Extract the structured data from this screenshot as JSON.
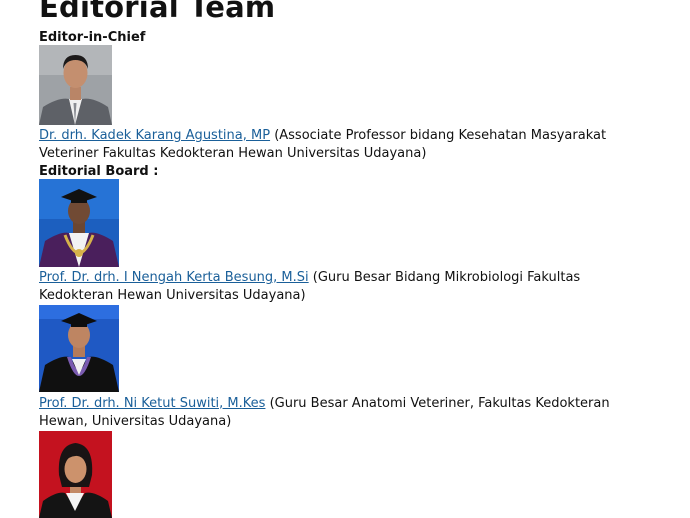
{
  "page": {
    "title": "Editorial Team"
  },
  "editor_in_chief": {
    "heading": "Editor-in-Chief",
    "member": {
      "name": "Dr. drh. Kadek Karang Agustina, MP",
      "description": " (Associate Professor bidang Kesehatan Masyarakat Veteriner Fakultas Kedokteran Hewan Universitas Udayana)"
    }
  },
  "editorial_board": {
    "heading": "Editorial Board :",
    "members": [
      {
        "name": "Prof. Dr. drh. I Nengah Kerta Besung, M.Si",
        "description": " (Guru Besar Bidang Mikrobiologi Fakultas Kedokteran Hewan Universitas Udayana)"
      },
      {
        "name": "Prof. Dr. drh. Ni Ketut Suwiti, M.Kes",
        "description": " (Guru Besar Anatomi Veteriner, Fakultas Kedokteran Hewan, Universitas Udayana)"
      }
    ]
  },
  "colors": {
    "link": "#1a5f99",
    "text": "#111111"
  }
}
